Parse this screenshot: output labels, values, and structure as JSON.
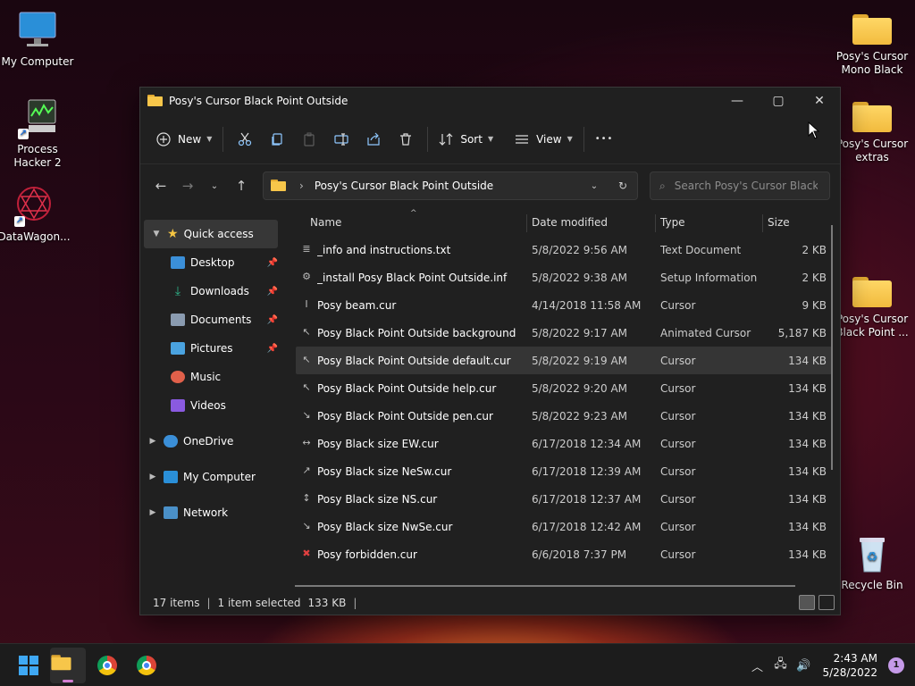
{
  "desktop": {
    "icons_left": [
      {
        "label": "My Computer",
        "icon": "monitor-icon"
      },
      {
        "label": "Process Hacker 2",
        "icon": "process-hacker-icon"
      },
      {
        "label": "DataWagon...",
        "icon": "datawagon-icon"
      }
    ],
    "icons_right": [
      {
        "label": "Posy's Cursor Mono Black",
        "icon": "folder-icon"
      },
      {
        "label": "Posy's Cursor extras",
        "icon": "folder-icon"
      },
      {
        "label": "Posy's Cursor Black Point ...",
        "icon": "folder-icon"
      },
      {
        "label": "Recycle Bin",
        "icon": "recycle-bin-icon"
      }
    ]
  },
  "window": {
    "title": "Posy's Cursor Black Point Outside",
    "controls": {
      "minimize": "—",
      "maximize": "▢",
      "close": "✕"
    },
    "toolbar": {
      "new_label": "New",
      "sort_label": "Sort",
      "view_label": "View",
      "more_label": "•••"
    },
    "address": {
      "path": "Posy's Cursor Black Point Outside",
      "separator": "›"
    },
    "search": {
      "placeholder": "Search Posy's Cursor Black P..."
    },
    "nav": {
      "quick_access": "Quick access",
      "items": [
        {
          "label": "Desktop",
          "color": "#3b8fd8",
          "pinned": true
        },
        {
          "label": "Downloads",
          "color": "#2fb58a",
          "pinned": true
        },
        {
          "label": "Documents",
          "color": "#8a9bb0",
          "pinned": true
        },
        {
          "label": "Pictures",
          "color": "#4aa3e0",
          "pinned": true
        },
        {
          "label": "Music",
          "color": "#e0604a",
          "pinned": false
        },
        {
          "label": "Videos",
          "color": "#8a5ae0",
          "pinned": false
        }
      ],
      "onedrive": "OneDrive",
      "my_computer": "My Computer",
      "network": "Network"
    },
    "columns": {
      "name": "Name",
      "date": "Date modified",
      "type": "Type",
      "size": "Size"
    },
    "files": [
      {
        "name": "_info and instructions.txt",
        "date": "5/8/2022 9:56 AM",
        "type": "Text Document",
        "size": "2 KB",
        "glyph": "≣"
      },
      {
        "name": "_install Posy Black Point Outside.inf",
        "date": "5/8/2022 9:38 AM",
        "type": "Setup Information",
        "size": "2 KB",
        "glyph": "⚙"
      },
      {
        "name": "Posy beam.cur",
        "date": "4/14/2018 11:58 AM",
        "type": "Cursor",
        "size": "9 KB",
        "glyph": "I"
      },
      {
        "name": "Posy Black Point Outside background m...",
        "date": "5/8/2022 9:17 AM",
        "type": "Animated Cursor",
        "size": "5,187 KB",
        "glyph": "↖"
      },
      {
        "name": "Posy Black Point Outside default.cur",
        "date": "5/8/2022 9:19 AM",
        "type": "Cursor",
        "size": "134 KB",
        "glyph": "↖"
      },
      {
        "name": "Posy Black Point Outside help.cur",
        "date": "5/8/2022 9:20 AM",
        "type": "Cursor",
        "size": "134 KB",
        "glyph": "↖"
      },
      {
        "name": "Posy Black Point Outside pen.cur",
        "date": "5/8/2022 9:23 AM",
        "type": "Cursor",
        "size": "134 KB",
        "glyph": "↘"
      },
      {
        "name": "Posy Black size EW.cur",
        "date": "6/17/2018 12:34 AM",
        "type": "Cursor",
        "size": "134 KB",
        "glyph": "↔"
      },
      {
        "name": "Posy Black size NeSw.cur",
        "date": "6/17/2018 12:39 AM",
        "type": "Cursor",
        "size": "134 KB",
        "glyph": "↗"
      },
      {
        "name": "Posy Black size NS.cur",
        "date": "6/17/2018 12:37 AM",
        "type": "Cursor",
        "size": "134 KB",
        "glyph": "↕"
      },
      {
        "name": "Posy Black size NwSe.cur",
        "date": "6/17/2018 12:42 AM",
        "type": "Cursor",
        "size": "134 KB",
        "glyph": "↘"
      },
      {
        "name": "Posy forbidden.cur",
        "date": "6/6/2018 7:37 PM",
        "type": "Cursor",
        "size": "134 KB",
        "glyph": "✖"
      }
    ],
    "selected_index": 4,
    "status": {
      "items": "17 items",
      "selected": "1 item selected",
      "size": "133 KB"
    }
  },
  "taskbar": {
    "time": "2:43 AM",
    "date": "5/28/2022",
    "notifications": "1"
  }
}
